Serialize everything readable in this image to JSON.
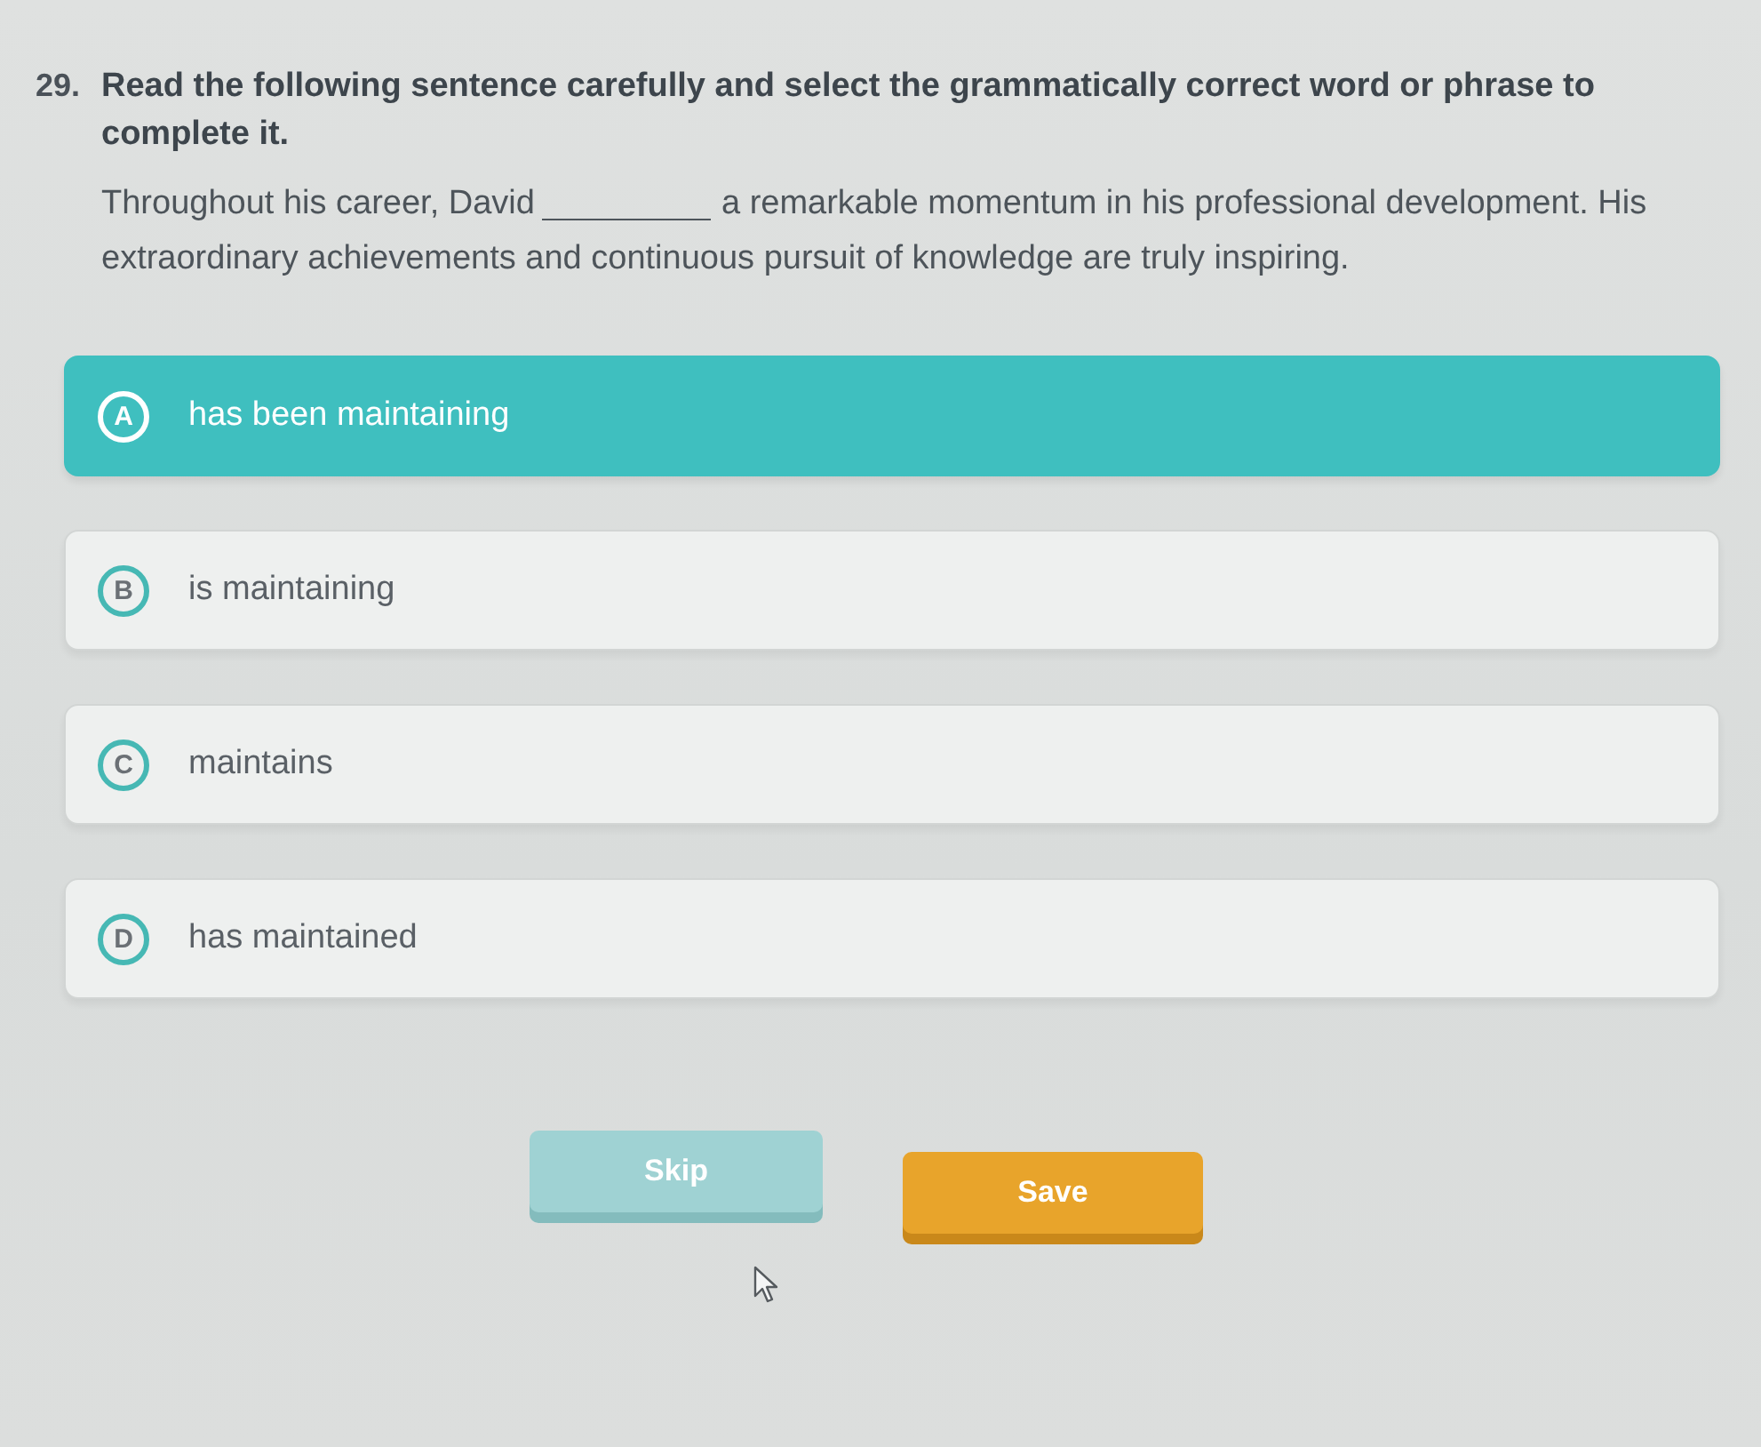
{
  "question": {
    "number": "29.",
    "prompt": "Read the following sentence carefully and select the grammatically correct word or phrase to complete it."
  },
  "sentence": {
    "before": "Throughout his career, David",
    "after": "a remarkable momentum in his professional development. His",
    "next_line": "extraordinary achievements and continuous pursuit of knowledge are truly inspiring."
  },
  "options": [
    {
      "letter": "A",
      "text": "has been maintaining",
      "selected": true
    },
    {
      "letter": "B",
      "text": "is maintaining",
      "selected": false
    },
    {
      "letter": "C",
      "text": "maintains",
      "selected": false
    },
    {
      "letter": "D",
      "text": "has maintained",
      "selected": false
    }
  ],
  "buttons": [
    {
      "label": "Skip",
      "kind": "skip"
    },
    {
      "label": "Save",
      "kind": "save"
    }
  ]
}
